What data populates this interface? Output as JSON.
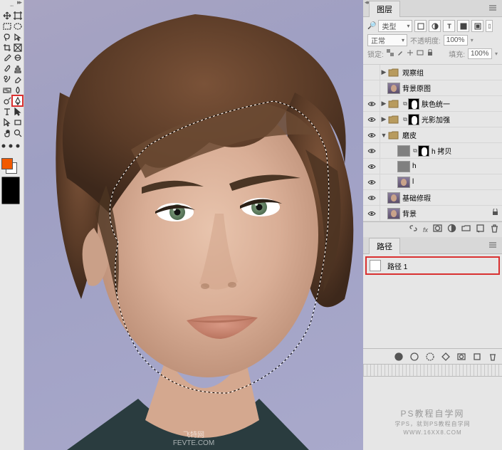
{
  "toolbox": {
    "tools": [
      "move",
      "artboard",
      "rect-marquee",
      "ellipse-marquee",
      "lasso",
      "quick-select",
      "crop",
      "frame",
      "eyedropper",
      "patch",
      "brush",
      "stamp",
      "history-brush",
      "eraser",
      "gradient",
      "blur",
      "dodge",
      "pen",
      "type",
      "path-select",
      "direct-select",
      "rectangle",
      "hand",
      "zoom"
    ],
    "highlighted_tool": "pen",
    "foreground_color": "#f25a00",
    "background_color": "#ffffff"
  },
  "canvas": {
    "watermark_center_line1": "飞特网",
    "watermark_center_line2": "FEVTE.COM"
  },
  "right_watermark": {
    "line1": "PS教程自学网",
    "line2": "学PS，就到PS教程自学网",
    "line3": "WWW.16XX8.COM"
  },
  "layers_panel": {
    "title": "图层",
    "filter_mode": "类型",
    "blend_mode": "正常",
    "opacity_label": "不透明度:",
    "opacity_value": "100%",
    "lock_label": "锁定:",
    "fill_label": "填充:",
    "fill_value": "100%",
    "layers": [
      {
        "visible": false,
        "type": "group",
        "name": "观察组",
        "indent": 0,
        "disclose": "▶"
      },
      {
        "visible": false,
        "type": "face",
        "name": "背景原图",
        "indent": 0
      },
      {
        "visible": true,
        "type": "group",
        "name": "肤色统一",
        "indent": 0,
        "disclose": "▶",
        "mask": true
      },
      {
        "visible": true,
        "type": "group",
        "name": "光影加强",
        "indent": 0,
        "disclose": "▶",
        "mask": true
      },
      {
        "visible": true,
        "type": "group",
        "name": "磨皮",
        "indent": 0,
        "disclose": "▼"
      },
      {
        "visible": true,
        "type": "gray",
        "name": "h 拷贝",
        "indent": 1,
        "mask": true
      },
      {
        "visible": true,
        "type": "gray",
        "name": "h",
        "indent": 1
      },
      {
        "visible": true,
        "type": "face",
        "name": "l",
        "indent": 1
      },
      {
        "visible": true,
        "type": "face",
        "name": "基础修瑕",
        "indent": 0
      },
      {
        "visible": true,
        "type": "face",
        "name": "背景",
        "indent": 0,
        "locked": true
      }
    ]
  },
  "paths_panel": {
    "title": "路径",
    "paths": [
      {
        "name": "路径 1"
      }
    ]
  }
}
